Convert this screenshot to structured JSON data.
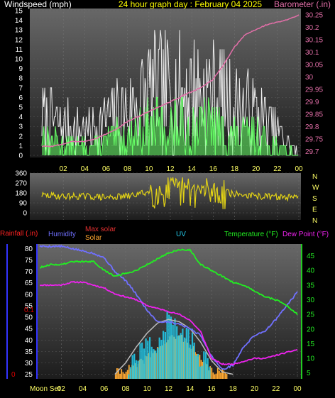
{
  "colors": {
    "wind_avg": "#66ff66",
    "wind_gust": "#eeeeee",
    "barometer": "#e36fa8",
    "direction": "#e3d315",
    "humidity": "#7070ff",
    "temperature": "#22ee22",
    "dewpoint": "#ee22ee",
    "solar": "#ffa830",
    "uv": "#22c8e8",
    "max_solar": "#bbbbbb",
    "rain": "#e00000",
    "tick_text": "#ffff66",
    "header_white": "#ffffff",
    "header_yellow": "#ffff00",
    "panel_bg_top": "#686868",
    "panel_bg_bottom": "#1c1c1c",
    "axis_blue": "#3333ff",
    "axis_green": "#22cc22"
  },
  "top": {
    "title_left": "Windspeed (mph)",
    "title_center": "24 hour graph day : February 04 2025",
    "title_right": "Barometer (.in)",
    "y_left_ticks": [
      "0",
      "1",
      "2",
      "3",
      "4",
      "5",
      "6",
      "7",
      "8",
      "9",
      "10",
      "11",
      "12",
      "13",
      "14",
      "15"
    ],
    "y_right_ticks": [
      "29.7",
      "29.75",
      "29.8",
      "29.85",
      "29.9",
      "29.95",
      "30",
      "30.05",
      "30.1",
      "30.15",
      "30.2",
      "30.25"
    ]
  },
  "x_ticks": [
    "02",
    "04",
    "06",
    "08",
    "10",
    "12",
    "14",
    "16",
    "18",
    "20",
    "22",
    "00"
  ],
  "mid": {
    "y_left_ticks": [
      "0",
      "90",
      "180",
      "270",
      "360"
    ],
    "compass": [
      "N",
      "W",
      "S",
      "E",
      "N"
    ]
  },
  "bottom": {
    "label_rain": "Rainfall (.in)",
    "label_humidity": "Humidity",
    "label_max_solar": "Max solar",
    "label_solar": "Solar",
    "label_uv": "UV",
    "label_temperature": "Temperature (°F)",
    "label_dewpoint": "Dew Point (°F)",
    "label_moon": "Moon Set",
    "y_left_ticks": [
      "25",
      "30",
      "35",
      "40",
      "45",
      "50",
      "55",
      "60",
      "65",
      "70",
      "75",
      "80"
    ],
    "y_right_ticks": [
      "5",
      "10",
      "15",
      "20",
      "25",
      "30",
      "35",
      "40",
      "45"
    ],
    "rain_ticks": [
      "0",
      "0.1"
    ]
  },
  "chart_data": [
    {
      "type": "line",
      "title": "24 hour graph day : February 04 2025",
      "x": [
        "02",
        "04",
        "06",
        "08",
        "10",
        "12",
        "14",
        "16",
        "18",
        "20",
        "22",
        "00"
      ],
      "ylabel": "Windspeed (mph)",
      "ylim": [
        0,
        15
      ],
      "y2label": "Barometer (.in)",
      "y2lim": [
        29.675,
        30.275
      ],
      "series": [
        {
          "name": "Barometer (.in)",
          "axis": "right",
          "x_hours": [
            0,
            1,
            2,
            3,
            4,
            5,
            6,
            7,
            8,
            9,
            10,
            11,
            12,
            13,
            14,
            15,
            16,
            17,
            18,
            19,
            20,
            21,
            22,
            23,
            24
          ],
          "values": [
            29.72,
            29.72,
            29.73,
            29.74,
            29.74,
            29.75,
            29.77,
            29.79,
            29.82,
            29.84,
            29.86,
            29.88,
            29.9,
            29.92,
            29.94,
            29.96,
            29.99,
            30.05,
            30.12,
            30.17,
            30.19,
            30.21,
            30.22,
            30.23,
            30.25
          ]
        },
        {
          "axis": "left",
          "x_hours": [
            0,
            2,
            4,
            6,
            8,
            10,
            12,
            14,
            16,
            18,
            20,
            22,
            24
          ],
          "values": [
            4,
            2,
            2,
            3,
            4,
            6,
            6,
            6,
            6,
            4,
            4,
            2,
            0
          ]
        },
        {
          "axis": "left",
          "x_hours": [
            0,
            2,
            4,
            6,
            8,
            10,
            12,
            14,
            16,
            18,
            20,
            22,
            24
          ],
          "values": [
            8,
            6,
            5,
            7,
            9,
            13,
            13,
            13,
            13,
            10,
            8,
            5,
            0
          ]
        }
      ]
    },
    {
      "type": "line",
      "ylabel": "",
      "ylim": [
        0,
        360
      ],
      "series": [
        {
          "x_hours": [
            0,
            2,
            4,
            6,
            8,
            10,
            12,
            14,
            16,
            18,
            20,
            22,
            24
          ],
          "values": [
            160,
            150,
            150,
            140,
            150,
            190,
            190,
            190,
            190,
            170,
            150,
            145,
            135
          ]
        }
      ]
    },
    {
      "type": "line",
      "ylabel": "Humidity",
      "ylim": [
        23,
        82
      ],
      "y2label": "Temperature (°F)",
      "y2lim": [
        3,
        49
      ],
      "series": [
        {
          "name": "Humidity",
          "axis": "left",
          "x_hours": [
            0,
            1,
            2,
            3,
            4,
            5,
            6,
            7,
            8,
            9,
            10,
            11,
            12,
            13,
            14,
            15,
            16,
            17,
            18,
            19,
            20,
            21,
            22,
            23,
            24
          ],
          "values": [
            81,
            81,
            81,
            80,
            79,
            78,
            76,
            70,
            66,
            60,
            53,
            48,
            48,
            47,
            45,
            42,
            33,
            27,
            29,
            37,
            42,
            44,
            49,
            55,
            61
          ]
        },
        {
          "name": "Temperature (°F)",
          "axis": "right",
          "x_hours": [
            0,
            1,
            2,
            3,
            4,
            5,
            6,
            7,
            8,
            9,
            10,
            11,
            12,
            13,
            14,
            15,
            16,
            17,
            18,
            19,
            20,
            21,
            22,
            23,
            24
          ],
          "values": [
            41,
            42,
            42,
            43,
            43,
            43,
            40,
            38,
            39,
            40,
            42,
            44,
            46,
            47,
            47,
            42,
            40,
            38,
            36,
            35,
            33,
            31,
            30,
            28,
            25
          ]
        },
        {
          "name": "Dew Point (°F)",
          "axis": "right",
          "x_hours": [
            0,
            1,
            2,
            3,
            4,
            5,
            6,
            7,
            8,
            9,
            10,
            11,
            12,
            13,
            14,
            15,
            16,
            17,
            18,
            19,
            20,
            21,
            22,
            23,
            24
          ],
          "values": [
            35,
            35,
            35,
            36,
            36,
            35,
            34,
            32,
            31,
            30,
            28,
            27,
            26,
            25,
            23,
            19,
            10,
            8,
            8,
            9,
            10,
            10,
            11,
            12,
            13
          ]
        },
        {
          "name": "Max solar",
          "axis": "left",
          "x_hours": [
            7,
            8,
            9,
            10,
            11,
            12,
            13,
            14,
            15,
            16,
            17,
            18
          ],
          "values": [
            25,
            30,
            37,
            43,
            47.5,
            49,
            48,
            45,
            39,
            31,
            26,
            25
          ]
        },
        {
          "name": "Solar",
          "axis": "left",
          "x_hours": [
            7,
            8,
            9,
            10,
            11,
            12,
            13,
            14,
            15,
            16,
            17,
            18
          ],
          "values": [
            25,
            26.5,
            28,
            32,
            36,
            40,
            41,
            37,
            30,
            26,
            25,
            25
          ]
        },
        {
          "name": "UV",
          "axis": "left",
          "x_hours": [
            8,
            9,
            10,
            11,
            12,
            13,
            14,
            15,
            16
          ],
          "values": [
            26,
            33,
            38,
            41,
            50,
            45,
            40,
            32,
            27
          ]
        }
      ]
    }
  ]
}
